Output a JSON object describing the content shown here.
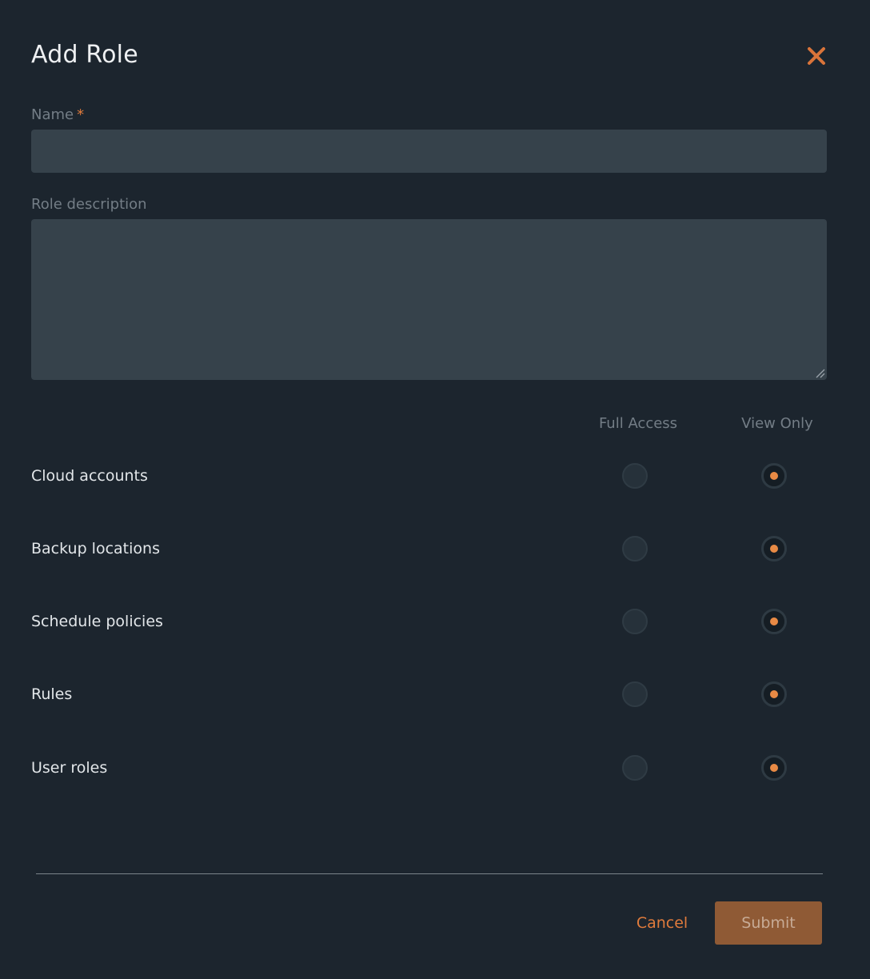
{
  "dialog": {
    "title": "Add Role",
    "close_icon": "close-icon"
  },
  "form": {
    "name_label": "Name",
    "name_required_mark": "*",
    "name_value": "",
    "description_label": "Role description",
    "description_value": ""
  },
  "permissions": {
    "columns": [
      "Full Access",
      "View Only"
    ],
    "rows": [
      {
        "label": "Cloud accounts",
        "selected": "View Only"
      },
      {
        "label": "Backup locations",
        "selected": "View Only"
      },
      {
        "label": "Schedule policies",
        "selected": "View Only"
      },
      {
        "label": "Rules",
        "selected": "View Only"
      },
      {
        "label": "User roles",
        "selected": "View Only"
      }
    ]
  },
  "footer": {
    "cancel_label": "Cancel",
    "submit_label": "Submit"
  },
  "colors": {
    "background": "#1c252e",
    "input_background": "#36424b",
    "accent": "#e07b3c",
    "submit_background": "#8f5a35"
  }
}
